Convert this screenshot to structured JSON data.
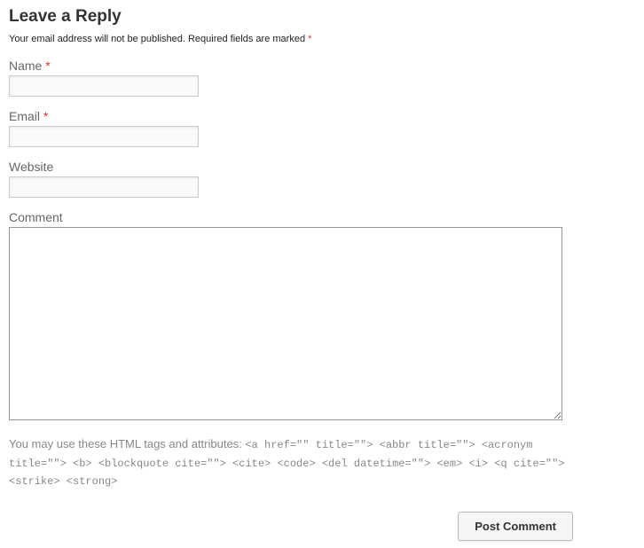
{
  "header": {
    "title": "Leave a Reply"
  },
  "notice": {
    "text_before": "Your email address will not be published. Required fields are marked ",
    "asterisk": "*"
  },
  "fields": {
    "name": {
      "label": "Name",
      "required": "*",
      "value": ""
    },
    "email": {
      "label": "Email",
      "required": "*",
      "value": ""
    },
    "website": {
      "label": "Website",
      "value": ""
    },
    "comment": {
      "label": "Comment",
      "value": ""
    }
  },
  "allowed_tags": {
    "intro": "You may use these HTML tags and attributes: ",
    "code": "<a href=\"\" title=\"\"> <abbr title=\"\"> <acronym title=\"\"> <b> <blockquote cite=\"\"> <cite> <code> <del datetime=\"\"> <em> <i> <q cite=\"\"> <strike> <strong>"
  },
  "submit": {
    "label": "Post Comment"
  }
}
